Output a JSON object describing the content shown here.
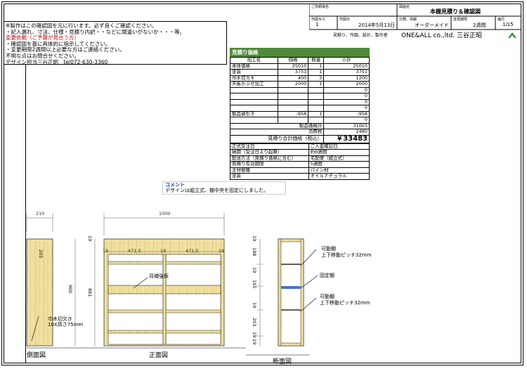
{
  "title_block": {
    "customer_label": "ご依頼様名",
    "drawing_name_label": "図面名",
    "drawing_name": "本棚見積り＆確認図",
    "drawing_no_label": "作図ＮＯ",
    "drawing_no": "1",
    "date_label": "作図日",
    "date": "2014年5月13日",
    "category_label": "分類、情報",
    "category": "オーダーメイド",
    "delivery_label": "変更期限",
    "delivery": "2週間",
    "scale_label": "縮尺",
    "scale": "1/15",
    "company_caption": "見積り、作図、設計、製作者",
    "company": "ONE&ALL co.,ltd. 三谷正昭"
  },
  "notes": {
    "lines": [
      {
        "text": "※製作はこの確認図を元に行います。必ず良くご確認ください。",
        "red": false
      },
      {
        "text": "・記入漏れ、寸法、仕様・見積り内訳・・などに間違いがないか・・・等。",
        "red": false
      },
      {
        "text": "変更依頼（ご予算が見合う方）",
        "red": true
      },
      {
        "text": "・確認図を基に具体的に指示してください。",
        "red": false
      },
      {
        "text": "・変更期限2週間以上必要な方はご連絡ください。",
        "red": false
      },
      {
        "text": "不明な点はお問合せください。",
        "red": false
      },
      {
        "text": "デザイン担当三谷正昭　tel072-630-3360",
        "red": false
      }
    ]
  },
  "estimate": {
    "header": "見積り価格",
    "columns": [
      "加工名",
      "価格",
      "数量",
      "小計"
    ],
    "rows": [
      [
        "本体価格",
        "25010",
        "1",
        "25010"
      ],
      [
        "塗装",
        "3751",
        "1",
        "3751"
      ],
      [
        "巾木切カキ",
        "400",
        "3",
        "1200"
      ],
      [
        "天板かぶせ加工",
        "2000",
        "1",
        "2000"
      ],
      [
        "",
        "",
        "",
        "0"
      ],
      [
        "",
        "",
        "",
        "0"
      ],
      [
        "",
        "",
        "",
        "0"
      ],
      [
        "",
        "",
        "",
        "0"
      ],
      [
        "製品値引き",
        "-958",
        "1",
        "-958"
      ],
      [
        "",
        "",
        "",
        "0"
      ]
    ],
    "product_total_label": "製品価格計",
    "product_total": "31003",
    "tax_label": "消費税",
    "tax": "2480",
    "grand_total_label": "見積り合計価格（税込）",
    "grand_total": "￥33483",
    "info": [
      [
        "正式受注日",
        "ご入金確認日"
      ],
      [
        "納期（受注日より起算）",
        "約6週間"
      ],
      [
        "配送方法（見積り価格に含む）",
        "宅配便（組立式）"
      ],
      [
        "見積り有効期限",
        "5週間"
      ],
      [
        "主材樹種",
        "パイン材"
      ],
      [
        "塗装",
        "オイルナチュラル"
      ]
    ]
  },
  "comment": {
    "label": "コメント",
    "text": "デザインは組立式、棚中央を固定にしました。"
  },
  "drawing": {
    "side_label": "側面図",
    "front_label": "正面図",
    "section_label": "断面図",
    "dims": {
      "side_width": "210",
      "front_width": "1000",
      "height": "900",
      "inner_height": "881",
      "top_thk": "19",
      "bay1": "471.5",
      "bay2": "471.5",
      "side_thk": "19",
      "side_inner": "205",
      "sec_top": "19",
      "sec_188": "188",
      "sec_19a": "19",
      "sec_165": "165",
      "sec_19b": "19",
      "sec_203": "203",
      "sec_19c": "19",
      "sec_bottom": "19"
    },
    "callouts": {
      "back_brace": "背補強板",
      "baseboard": "巾木切欠き",
      "baseboard_size": "10X高さ75mm",
      "movable_upper": "可動棚",
      "movable_upper_pitch": "上下移動ピッチ32mm",
      "fixed": "固定棚",
      "movable_lower": "可動棚",
      "movable_lower_pitch": "上下移動ピッチ32mm"
    }
  }
}
